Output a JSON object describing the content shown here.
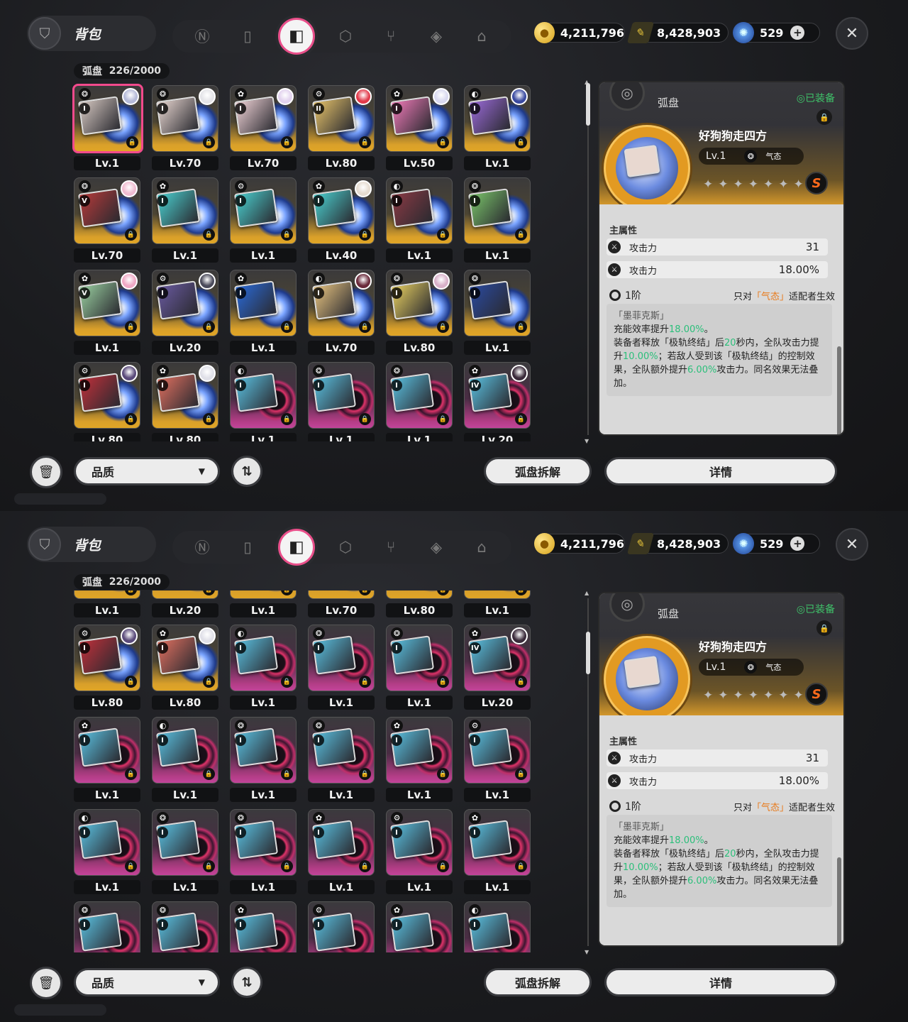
{
  "colors": {
    "accent": "#e94f8a",
    "gold_frame": "#e0a526",
    "purple_frame": "#c2449a",
    "equipped_green": "#3fc36a",
    "highlight_orange": "#e87a1b",
    "value_green": "#2bbf7a"
  },
  "header": {
    "title": "背包",
    "tabs": [
      {
        "icon": "n-logo-icon"
      },
      {
        "icon": "gameboy-icon"
      },
      {
        "icon": "disc-case-icon"
      },
      {
        "icon": "box-icon"
      },
      {
        "icon": "utensils-icon"
      },
      {
        "icon": "cube-icon"
      },
      {
        "icon": "house-icon"
      }
    ],
    "active_tab": 2,
    "currency": [
      {
        "icon": "gold-coin-icon",
        "value": "4,211,796"
      },
      {
        "icon": "ticket-icon",
        "value": "8,428,903"
      },
      {
        "icon": "blue-crystal-icon",
        "value": "529"
      }
    ]
  },
  "inventory": {
    "label": "弧盘",
    "count": "226/2000"
  },
  "rows": [
    [
      {
        "lv": "Lv.1",
        "tier": "I",
        "frame": "gold",
        "sel": true,
        "av": "#b4b9d8",
        "art": "#d7c9c2"
      },
      {
        "lv": "Lv.70",
        "tier": "I",
        "frame": "gold",
        "av": "#e4e4e8",
        "art": "#e8d6d0"
      },
      {
        "lv": "Lv.70",
        "tier": "I",
        "frame": "gold",
        "av": "#e2d2ee",
        "art": "#f0d2d6"
      },
      {
        "lv": "Lv.80",
        "tier": "II",
        "frame": "gold",
        "av": "#e23a4a",
        "art": "#e8c46a"
      },
      {
        "lv": "Lv.50",
        "tier": "I",
        "frame": "gold",
        "av": "#d9d9f0",
        "art": "#f07ab8"
      },
      {
        "lv": "Lv.1",
        "tier": "I",
        "frame": "gold",
        "av": "#3a4aa0",
        "art": "#9a6ad8"
      }
    ],
    [
      {
        "lv": "Lv.70",
        "tier": "V",
        "frame": "gold",
        "av": "#f0bcd0",
        "art": "#b63a3a"
      },
      {
        "lv": "Lv.1",
        "tier": "I",
        "frame": "gold",
        "art": "#4ad0d0"
      },
      {
        "lv": "Lv.1",
        "tier": "I",
        "frame": "gold",
        "art": "#4ad0d0"
      },
      {
        "lv": "Lv.40",
        "tier": "I",
        "frame": "gold",
        "av": "#e6dcd0",
        "art": "#4ad0d0"
      },
      {
        "lv": "Lv.1",
        "tier": "I",
        "frame": "gold",
        "art": "#8a3a44"
      },
      {
        "lv": "Lv.1",
        "tier": "I",
        "frame": "gold",
        "art": "#7ac46a"
      }
    ],
    [
      {
        "lv": "Lv.1",
        "tier": "V",
        "frame": "gold",
        "av": "#f0a8c4",
        "art": "#9ad0a0"
      },
      {
        "lv": "Lv.20",
        "tier": "I",
        "frame": "gold",
        "av": "#4a4a5a",
        "art": "#6a5aa0"
      },
      {
        "lv": "Lv.1",
        "tier": "I",
        "frame": "gold",
        "art": "#2a6ad8"
      },
      {
        "lv": "Lv.70",
        "tier": "I",
        "frame": "gold",
        "av": "#6a2a3a",
        "art": "#e8c480"
      },
      {
        "lv": "Lv.80",
        "tier": "I",
        "frame": "gold",
        "av": "#d8b0c8",
        "art": "#e8d060"
      },
      {
        "lv": "Lv.1",
        "tier": "I",
        "frame": "gold",
        "art": "#2a4aa0"
      }
    ],
    [
      {
        "lv": "Lv.80",
        "tier": "I",
        "frame": "gold",
        "av": "#5a4a7a",
        "art": "#c0303a"
      },
      {
        "lv": "Lv.80",
        "tier": "I",
        "frame": "gold",
        "av": "#e0e0e8",
        "art": "#e07060"
      },
      {
        "lv": "Lv.1",
        "tier": "I",
        "frame": "pink",
        "art": "#5ac0e0"
      },
      {
        "lv": "Lv.1",
        "tier": "I",
        "frame": "pink",
        "art": "#5ac0e0"
      },
      {
        "lv": "Lv.1",
        "tier": "I",
        "frame": "pink",
        "art": "#5ac0e0"
      },
      {
        "lv": "Lv.20",
        "tier": "IV",
        "frame": "pink",
        "av": "#3a2a3a",
        "art": "#5ac0e0"
      }
    ],
    [
      {
        "lv": "Lv.1",
        "tier": "I",
        "frame": "pink",
        "art": "#5ac0e0"
      },
      {
        "lv": "Lv.1",
        "tier": "I",
        "frame": "pink",
        "art": "#5ac0e0"
      },
      {
        "lv": "Lv.1",
        "tier": "I",
        "frame": "pink",
        "art": "#5ac0e0"
      },
      {
        "lv": "Lv.1",
        "tier": "I",
        "frame": "pink",
        "art": "#5ac0e0"
      },
      {
        "lv": "Lv.1",
        "tier": "I",
        "frame": "pink",
        "art": "#5ac0e0"
      },
      {
        "lv": "Lv.1",
        "tier": "I",
        "frame": "pink",
        "art": "#5ac0e0"
      }
    ],
    [
      {
        "lv": "Lv.1",
        "tier": "I",
        "frame": "pink",
        "art": "#5ac0e0"
      },
      {
        "lv": "Lv.1",
        "tier": "I",
        "frame": "pink",
        "art": "#5ac0e0"
      },
      {
        "lv": "Lv.1",
        "tier": "I",
        "frame": "pink",
        "art": "#5ac0e0"
      },
      {
        "lv": "Lv.1",
        "tier": "I",
        "frame": "pink",
        "art": "#5ac0e0"
      },
      {
        "lv": "Lv.1",
        "tier": "I",
        "frame": "pink",
        "art": "#5ac0e0"
      },
      {
        "lv": "Lv.1",
        "tier": "I",
        "frame": "pink",
        "art": "#5ac0e0"
      }
    ],
    [
      {
        "lv": "",
        "tier": "I",
        "frame": "pink",
        "art": "#5ac0e0"
      },
      {
        "lv": "",
        "tier": "I",
        "frame": "pink",
        "art": "#5ac0e0"
      },
      {
        "lv": "",
        "tier": "I",
        "frame": "pink",
        "art": "#5ac0e0"
      },
      {
        "lv": "",
        "tier": "I",
        "frame": "pink",
        "art": "#5ac0e0"
      },
      {
        "lv": "",
        "tier": "I",
        "frame": "pink",
        "art": "#5ac0e0"
      },
      {
        "lv": "",
        "tier": "I",
        "frame": "pink",
        "art": "#5ac0e0"
      }
    ]
  ],
  "detail": {
    "category": "弧盘",
    "equipped": "◎已装备",
    "name": "好狗狗走四方",
    "level": "Lv.1",
    "type": "气态",
    "rank": "S",
    "stars": "✦✦✦✦✦✦✦",
    "main_label": "主属性",
    "stats": [
      {
        "name": "攻击力",
        "value": "31"
      },
      {
        "name": "攻击力",
        "value": "18.00%"
      }
    ],
    "tier": "1阶",
    "only_a": "只对",
    "only_hl": "「气态」",
    "only_b": "适配者生效",
    "set_name": "「墨菲克斯」",
    "desc_1a": "充能效率提升",
    "desc_1b": "18.00%",
    "desc_1c": "。",
    "desc_2a": "装备者释放「极轨终结」后",
    "desc_2b": "20",
    "desc_2c": "秒内，全队攻击力提升",
    "desc_2d": "10.00%",
    "desc_2e": "；若敌人受到该「极轨终结」的控制效果，全队额外提升",
    "desc_2f": "6.00%",
    "desc_2g": "攻击力。同名效果无法叠加。"
  },
  "footer": {
    "quality": "品质",
    "dismantle": "弧盘拆解",
    "details": "详情"
  }
}
